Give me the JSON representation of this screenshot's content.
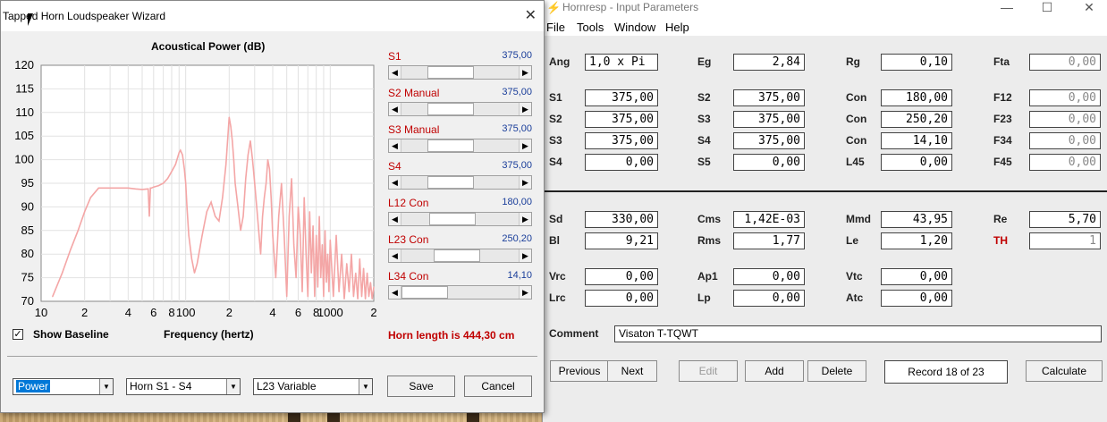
{
  "main": {
    "title": "Hornresp - Input Parameters",
    "menu": [
      "File",
      "Tools",
      "Window",
      "Help"
    ],
    "params": {
      "Ang": "1,0 x Pi",
      "Eg": "2,84",
      "Rg": "0,10",
      "Fta": "0,00",
      "r1_S1": "375,00",
      "r1_S2": "375,00",
      "r1_Con": "180,00",
      "r1_F12": "0,00",
      "r2_S2": "375,00",
      "r2_S3": "375,00",
      "r2_Con": "250,20",
      "r2_F23": "0,00",
      "r3_S3": "375,00",
      "r3_S4": "375,00",
      "r3_Con": "14,10",
      "r3_F34": "0,00",
      "r4_S4": "0,00",
      "r4_S5": "0,00",
      "r4_L45": "0,00",
      "r4_F45": "0,00",
      "Sd": "330,00",
      "Cms": "1,42E-03",
      "Mmd": "43,95",
      "Re": "5,70",
      "Bl": "9,21",
      "Rms": "1,77",
      "Le": "1,20",
      "TH": "1",
      "Vrc": "0,00",
      "Ap1": "0,00",
      "Vtc": "0,00",
      "Lrc": "0,00",
      "Lp": "0,00",
      "Atc": "0,00"
    },
    "labels": {
      "Ang": "Ang",
      "Eg": "Eg",
      "Rg": "Rg",
      "Fta": "Fta",
      "S1": "S1",
      "S2": "S2",
      "S3": "S3",
      "S4": "S4",
      "S5": "S5",
      "Con": "Con",
      "L45": "L45",
      "F12": "F12",
      "F23": "F23",
      "F34": "F34",
      "F45": "F45",
      "Sd": "Sd",
      "Cms": "Cms",
      "Mmd": "Mmd",
      "Re": "Re",
      "Bl": "Bl",
      "Rms": "Rms",
      "Le": "Le",
      "TH": "TH",
      "Vrc": "Vrc",
      "Ap1": "Ap1",
      "Vtc": "Vtc",
      "Lrc": "Lrc",
      "Lp": "Lp",
      "Atc": "Atc",
      "Comment": "Comment"
    },
    "comment": "Visaton T-TQWT",
    "buttons": {
      "previous": "Previous",
      "next": "Next",
      "edit": "Edit",
      "add": "Add",
      "delete": "Delete",
      "calculate": "Calculate"
    },
    "record": "Record 18 of 23"
  },
  "wizard": {
    "title": "Tapped Horn Loudspeaker Wizard",
    "close": "✕",
    "sliders": [
      {
        "label": "S1",
        "value": "375,00",
        "pos": 0.37
      },
      {
        "label": "S2  Manual",
        "value": "375,00",
        "pos": 0.37
      },
      {
        "label": "S3  Manual",
        "value": "375,00",
        "pos": 0.37
      },
      {
        "label": "S4",
        "value": "375,00",
        "pos": 0.37
      },
      {
        "label": "L12  Con",
        "value": "180,00",
        "pos": 0.39
      },
      {
        "label": "L23  Con",
        "value": "250,20",
        "pos": 0.46
      },
      {
        "label": "L34  Con",
        "value": "14,10",
        "pos": 0.0
      }
    ],
    "horn_length": "Horn length is 444,30 cm",
    "show_baseline": "Show Baseline",
    "show_baseline_checked": "✓",
    "combos": [
      "Power",
      "Horn S1 - S4",
      "L23 Variable"
    ],
    "save": "Save",
    "cancel": "Cancel"
  },
  "chart_data": {
    "type": "line",
    "title": "Acoustical Power (dB)",
    "xlabel": "Frequency (hertz)",
    "ylabel": "",
    "x_scale": "log",
    "xlim": [
      10,
      2000
    ],
    "ylim": [
      70,
      120
    ],
    "grid": true,
    "y_ticks": [
      "120",
      "115",
      "110",
      "105",
      "100",
      "95",
      "90",
      "85",
      "80",
      "75",
      "70"
    ],
    "x_ticks": [
      {
        "v": 10,
        "t": "10"
      },
      {
        "v": 20,
        "t": "2"
      },
      {
        "v": 40,
        "t": "4"
      },
      {
        "v": 60,
        "t": "6"
      },
      {
        "v": 80,
        "t": "8"
      },
      {
        "v": 100,
        "t": "100"
      },
      {
        "v": 200,
        "t": "2"
      },
      {
        "v": 400,
        "t": "4"
      },
      {
        "v": 600,
        "t": "6"
      },
      {
        "v": 800,
        "t": "8"
      },
      {
        "v": 1000,
        "t": "1000"
      },
      {
        "v": 2000,
        "t": "2"
      }
    ],
    "color": "#f4a6a6",
    "series": [
      {
        "x": [
          12,
          14,
          16,
          18,
          20,
          22,
          25,
          30,
          35,
          40,
          45,
          50,
          55,
          56,
          57,
          58,
          60,
          65,
          70,
          75,
          80,
          85,
          90,
          92,
          95,
          98,
          100,
          102,
          105,
          110,
          115,
          120,
          130,
          140,
          150,
          160,
          170,
          180,
          190,
          200,
          205,
          210,
          215,
          220,
          230,
          240,
          250,
          260,
          270,
          280,
          290,
          300,
          310,
          320,
          330,
          340,
          350,
          360,
          370,
          380,
          390,
          400,
          420,
          440,
          460,
          480,
          500,
          520,
          540,
          560,
          580,
          600,
          620,
          640,
          660,
          680,
          700,
          720,
          740,
          760,
          780,
          800,
          820,
          840,
          860,
          880,
          900,
          920,
          940,
          960,
          980,
          1000,
          1050,
          1100,
          1150,
          1200,
          1250,
          1300,
          1350,
          1400,
          1450,
          1500,
          1550,
          1600,
          1650,
          1700,
          1750,
          1800,
          1850,
          1900,
          1950,
          2000
        ],
        "y": [
          71,
          76,
          81,
          85,
          89,
          92,
          94,
          94,
          94,
          94,
          93.8,
          93.7,
          93.8,
          88,
          94,
          94,
          94.2,
          94.5,
          95,
          96,
          97.5,
          99,
          101.5,
          102,
          101,
          98,
          95,
          90,
          84,
          79,
          76,
          78,
          84,
          89,
          91,
          88,
          87,
          92,
          99,
          109,
          107,
          104,
          100,
          95,
          90,
          85,
          88,
          96,
          101,
          104,
          100,
          95,
          90,
          85,
          80,
          88,
          92,
          95,
          100,
          98,
          92,
          84,
          75,
          88,
          95,
          84,
          71,
          88,
          96,
          82,
          75,
          90,
          84,
          72,
          92,
          80,
          71,
          89,
          76,
          86,
          71,
          84,
          73,
          88,
          75,
          82,
          71,
          85,
          74,
          80,
          72,
          83,
          71,
          84,
          72,
          80,
          70.5,
          78,
          72,
          80,
          71,
          76,
          70.5,
          79,
          71,
          77,
          70.5,
          76,
          71,
          74,
          70.5,
          73
        ]
      }
    ]
  }
}
